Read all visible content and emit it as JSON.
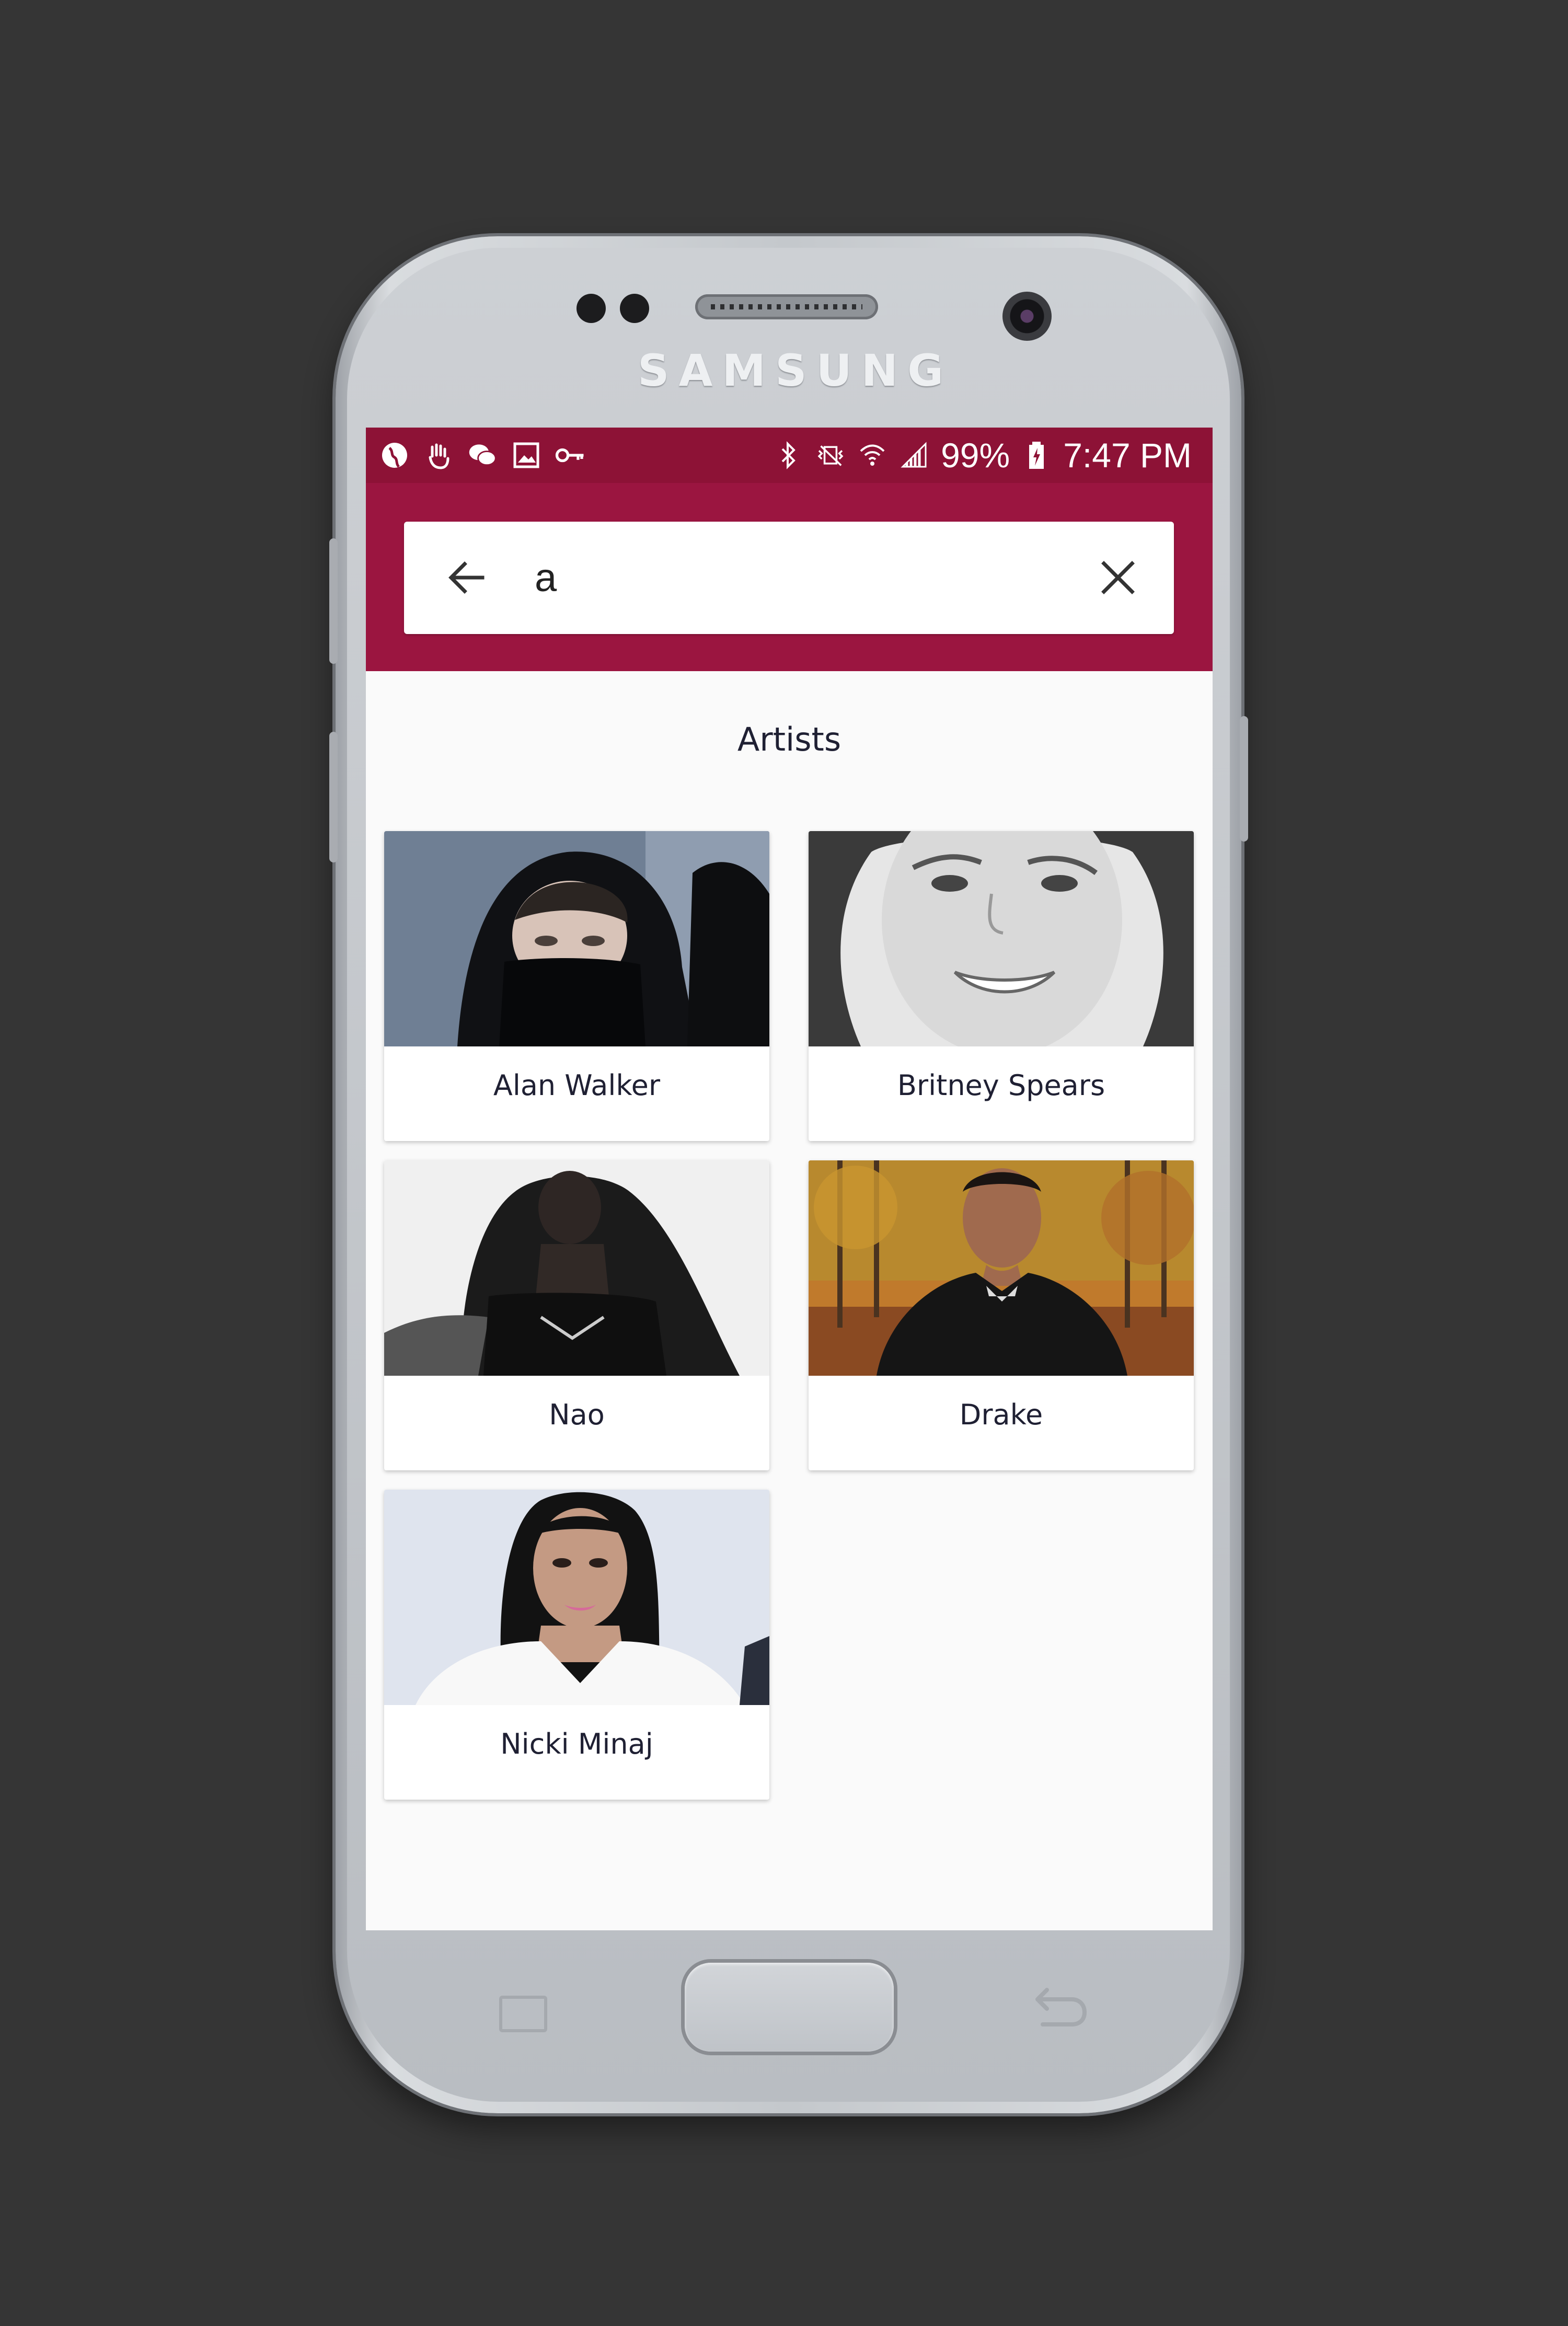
{
  "device": {
    "brand": "SAMSUNG"
  },
  "status_bar": {
    "left_icons": [
      "globe-icon",
      "hand-icon",
      "chat-icon",
      "image-icon",
      "key-icon"
    ],
    "right_icons": [
      "bluetooth-icon",
      "vibrate-icon",
      "wifi-icon",
      "signal-icon",
      "battery-icon"
    ],
    "battery": "99%",
    "time": "7:47 PM"
  },
  "search": {
    "value": "a",
    "back_icon": "arrow-left-icon",
    "clear_icon": "close-icon"
  },
  "section": {
    "title": "Artists"
  },
  "artists": [
    {
      "name": "Alan Walker"
    },
    {
      "name": "Britney Spears"
    },
    {
      "name": "Nao"
    },
    {
      "name": "Drake"
    },
    {
      "name": "Nicki Minaj"
    }
  ],
  "colors": {
    "status_bar": "#8d1236",
    "app_bar": "#9b1540",
    "background": "#fafafa",
    "text": "#1f2033"
  }
}
